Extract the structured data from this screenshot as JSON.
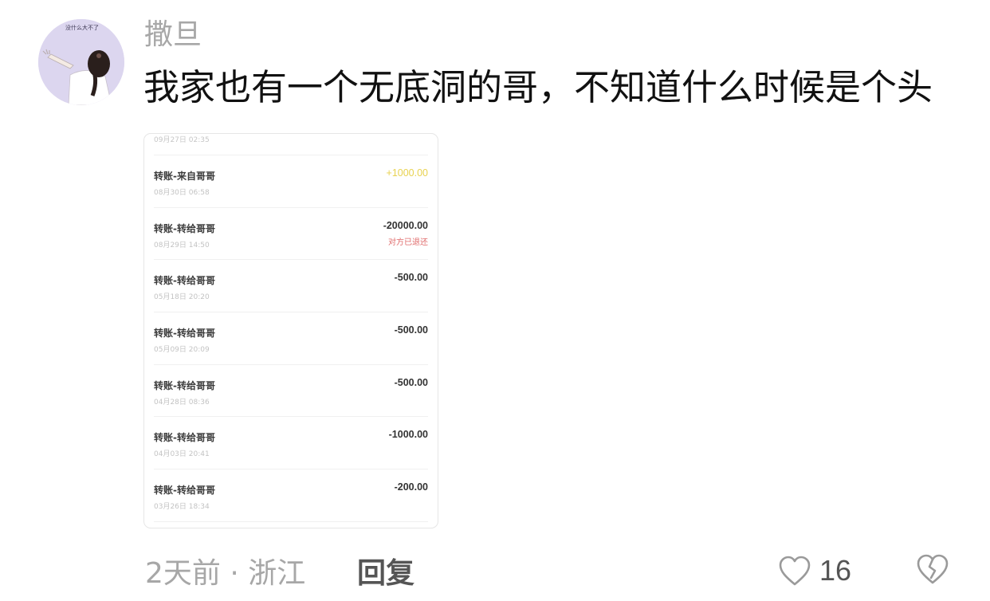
{
  "comment": {
    "avatar_caption": "没什么大不了",
    "username": "撒旦",
    "text": "我家也有一个无底洞的哥，不知道什么时候是个头",
    "attachment": {
      "cut_date": "09月27日 02:35",
      "transactions": [
        {
          "title": "转账-来自哥哥",
          "date": "08月30日 06:58",
          "amount": "+1000.00",
          "note": ""
        },
        {
          "title": "转账-转给哥哥",
          "date": "08月29日 14:50",
          "amount": "-20000.00",
          "note": "对方已退还"
        },
        {
          "title": "转账-转给哥哥",
          "date": "05月18日 20:20",
          "amount": "-500.00",
          "note": ""
        },
        {
          "title": "转账-转给哥哥",
          "date": "05月09日 20:09",
          "amount": "-500.00",
          "note": ""
        },
        {
          "title": "转账-转给哥哥",
          "date": "04月28日 08:36",
          "amount": "-500.00",
          "note": ""
        },
        {
          "title": "转账-转给哥哥",
          "date": "04月03日 20:41",
          "amount": "-1000.00",
          "note": ""
        },
        {
          "title": "转账-转给哥哥",
          "date": "03月26日 18:34",
          "amount": "-200.00",
          "note": ""
        }
      ]
    },
    "meta": "2天前 · 浙江",
    "reply_label": "回复",
    "like_count": "16",
    "icons": {
      "like": "heart-outline-icon",
      "dislike": "broken-heart-icon"
    }
  }
}
